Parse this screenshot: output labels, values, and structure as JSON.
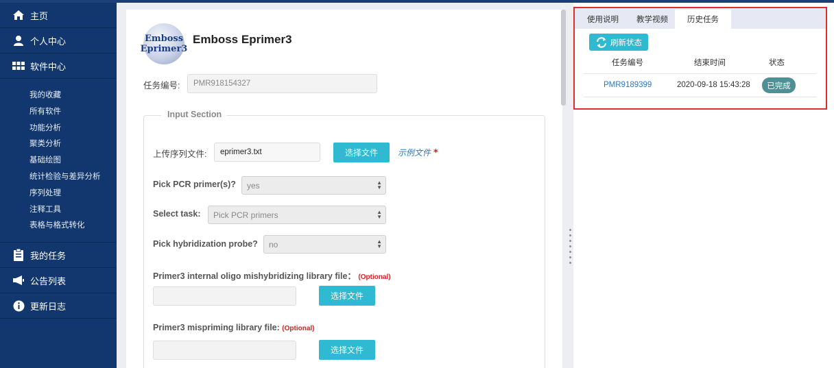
{
  "sidebar": {
    "main_items": [
      {
        "label": "主页",
        "icon": "home-icon"
      },
      {
        "label": "个人中心",
        "icon": "user-icon"
      },
      {
        "label": "软件中心",
        "icon": "grid-icon"
      }
    ],
    "sub_items": [
      "我的收藏",
      "所有软件",
      "功能分析",
      "聚类分析",
      "基础绘图",
      "统计检验与差异分析",
      "序列处理",
      "注释工具",
      "表格与格式转化"
    ],
    "bottom_items": [
      {
        "label": "我的任务",
        "icon": "clipboard-icon"
      },
      {
        "label": "公告列表",
        "icon": "megaphone-icon"
      },
      {
        "label": "更新日志",
        "icon": "info-icon"
      }
    ]
  },
  "app": {
    "logo_line1": "Emboss",
    "logo_line2": "Eprimer3",
    "title": "Emboss Eprimer3",
    "task_id_label": "任务编号:",
    "task_id_value": "PMR918154327"
  },
  "form": {
    "section_legend": "Input Section",
    "upload_label": "上传序列文件:",
    "upload_value": "eprimer3.txt",
    "choose_file": "选择文件",
    "example_file": "示例文件",
    "required_mark": "*",
    "pick_pcr_label": "Pick PCR primer(s)?",
    "pick_pcr_value": "yes",
    "select_task_label": "Select task:",
    "select_task_value": "Pick PCR primers",
    "hyb_probe_label": "Pick hybridization probe?",
    "hyb_probe_value": "no",
    "lib_label": "Primer3 internal oligo mishybridizing library file：",
    "lib_optional": "(Optional)",
    "mispriming_label": "Primer3 mispriming library file:",
    "mispriming_optional": "(Optional)"
  },
  "right_panel": {
    "tabs": [
      "使用说明",
      "教学视频",
      "历史任务"
    ],
    "active_tab": "历史任务",
    "refresh_label": "刷新状态",
    "columns": [
      "任务编号",
      "结束时间",
      "状态"
    ],
    "rows": [
      {
        "task_id": "PMR9189399",
        "end_time": "2020-09-18 15:43:28",
        "status": "已完成"
      }
    ]
  },
  "colors": {
    "sidebar_bg": "#12376e",
    "accent": "#2fbad2",
    "highlight_box": "#e32b2b",
    "status_badge": "#4f8f96",
    "link": "#2b79c2"
  }
}
